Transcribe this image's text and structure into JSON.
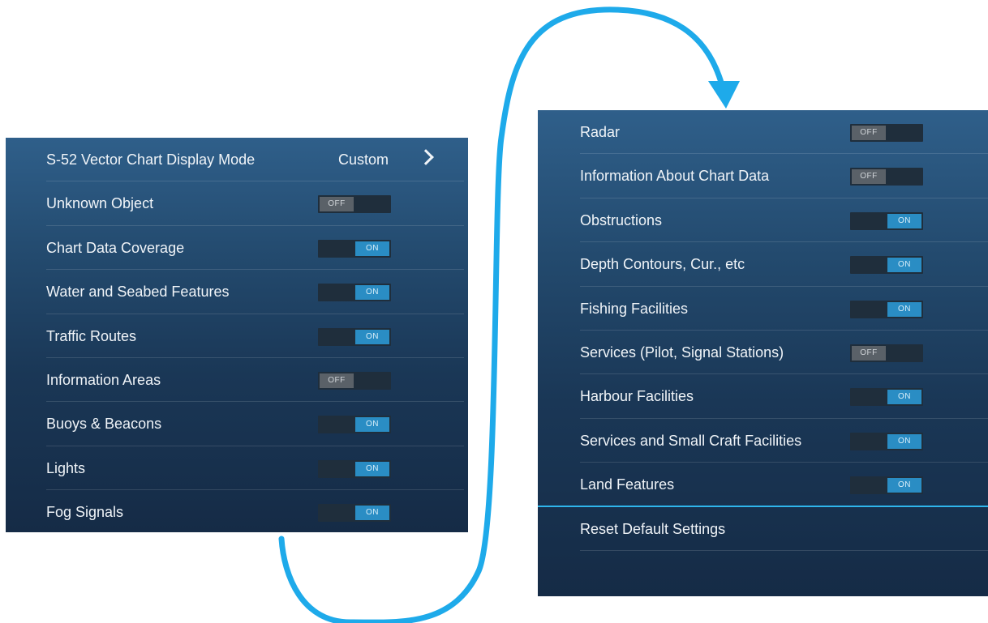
{
  "left_panel": {
    "rows": [
      {
        "label": "S-52 Vector Chart Display Mode",
        "value": "Custom",
        "type": "submenu"
      },
      {
        "label": "Unknown Object",
        "type": "toggle",
        "state": "OFF"
      },
      {
        "label": "Chart Data Coverage",
        "type": "toggle",
        "state": "ON"
      },
      {
        "label": "Water and Seabed Features",
        "type": "toggle",
        "state": "ON"
      },
      {
        "label": "Traffic Routes",
        "type": "toggle",
        "state": "ON"
      },
      {
        "label": "Information Areas",
        "type": "toggle",
        "state": "OFF"
      },
      {
        "label": "Buoys & Beacons",
        "type": "toggle",
        "state": "ON"
      },
      {
        "label": "Lights",
        "type": "toggle",
        "state": "ON"
      },
      {
        "label": "Fog Signals",
        "type": "toggle",
        "state": "ON"
      }
    ]
  },
  "right_panel": {
    "rows": [
      {
        "label": "Radar",
        "type": "toggle",
        "state": "OFF"
      },
      {
        "label": "Information About Chart Data",
        "type": "toggle",
        "state": "OFF"
      },
      {
        "label": "Obstructions",
        "type": "toggle",
        "state": "ON"
      },
      {
        "label": "Depth Contours, Cur., etc",
        "type": "toggle",
        "state": "ON"
      },
      {
        "label": "Fishing Facilities",
        "type": "toggle",
        "state": "ON"
      },
      {
        "label": "Services (Pilot, Signal Stations)",
        "type": "toggle",
        "state": "OFF"
      },
      {
        "label": "Harbour Facilities",
        "type": "toggle",
        "state": "ON"
      },
      {
        "label": "Services and Small Craft Facilities",
        "type": "toggle",
        "state": "ON"
      },
      {
        "label": "Land Features",
        "type": "toggle",
        "state": "ON"
      }
    ],
    "reset_label": "Reset Default Settings"
  },
  "colors": {
    "accent": "#2fb6ec",
    "toggle_on": "#2a8dc4",
    "toggle_off": "#5a6168",
    "panel_top": "#2f5f8a",
    "panel_bottom": "#152b46"
  },
  "icons": {
    "submenu": "chevron-right-icon",
    "connector": "continuation-arrow"
  }
}
